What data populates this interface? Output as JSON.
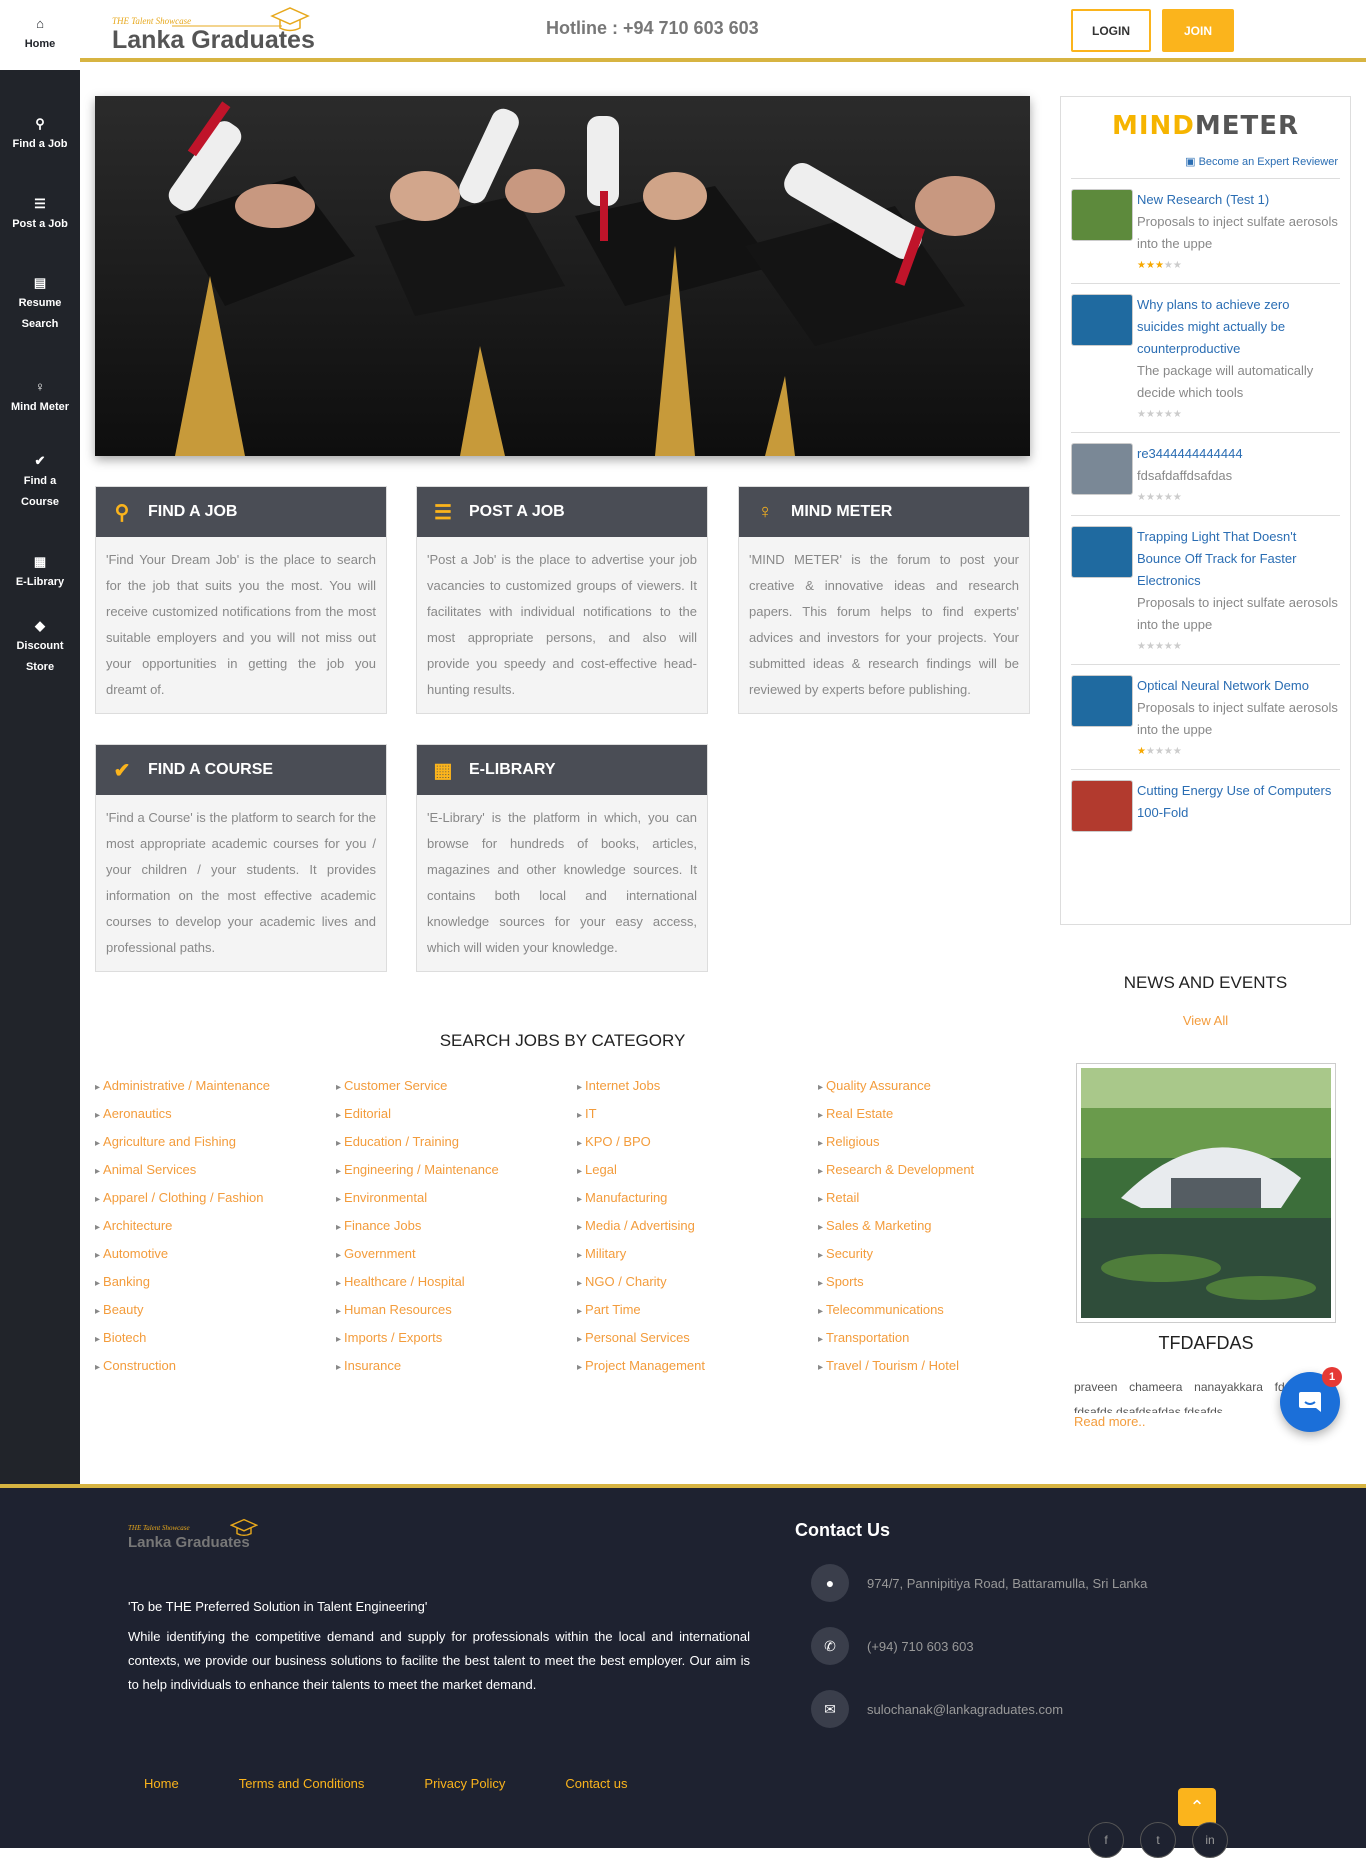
{
  "sidebar": {
    "items": [
      {
        "label": "Home",
        "icon": "home-icon",
        "glyph": "⌂"
      },
      {
        "label": "Find a Job",
        "icon": "search-icon",
        "glyph": "⚲"
      },
      {
        "label": "Post a Job",
        "icon": "list-icon",
        "glyph": "☰"
      },
      {
        "label": "Resume Search",
        "icon": "id-card-icon",
        "glyph": "▤"
      },
      {
        "label": "Mind Meter",
        "icon": "lightbulb-icon",
        "glyph": "♀"
      },
      {
        "label": "Find a Course",
        "icon": "check-icon",
        "glyph": "✔"
      },
      {
        "label": "E-Library",
        "icon": "book-icon",
        "glyph": "▦"
      },
      {
        "label": "Discount Store",
        "icon": "tags-icon",
        "glyph": "◆"
      }
    ]
  },
  "header": {
    "logo_tagline": "THE Talent Showcase",
    "logo_name": "Lanka Graduates",
    "hotline": "Hotline : +94 710 603 603",
    "login": "LOGIN",
    "join": "JOIN"
  },
  "cards": [
    {
      "title": "FIND A JOB",
      "icon": "search-icon",
      "glyph": "⚲",
      "text": "'Find Your Dream Job' is the place to search for the job that suits you the most. You will receive customized notifications from the most suitable employers and you will not miss out your opportunities in getting the job you dreamt of."
    },
    {
      "title": "POST A JOB",
      "icon": "list-icon",
      "glyph": "☰",
      "text": "'Post a Job' is the place to advertise your job vacancies to customized groups of viewers. It facilitates with individual notifications to the most appropriate persons, and also will provide you speedy and cost-effective head-hunting results."
    },
    {
      "title": "MIND METER",
      "icon": "lightbulb-icon",
      "glyph": "♀",
      "text": "'MIND METER' is the forum to post your creative & innovative ideas and research papers. This forum helps to find experts' advices and investors for your projects. Your submitted ideas & research findings will be reviewed by experts before publishing."
    },
    {
      "title": "FIND A COURSE",
      "icon": "check-icon",
      "glyph": "✔",
      "text": "'Find a Course' is the platform to search for the most appropriate academic courses for you / your children / your students. It provides information on the most effective academic courses to develop your academic lives and professional paths."
    },
    {
      "title": "E-LIBRARY",
      "icon": "book-icon",
      "glyph": "▦",
      "text": "'E-Library' is the platform in which, you can browse for hundreds of books, articles, magazines and other knowledge sources. It contains both local and international knowledge sources for your easy access, which will widen your knowledge."
    }
  ],
  "mindmeter": {
    "logo_a": "MIND",
    "logo_b": "METER",
    "reviewer_link": "Become an Expert Reviewer",
    "items": [
      {
        "title": "New Research (Test 1)",
        "desc": "Proposals to inject sulfate aerosols into the uppe",
        "rating": 3,
        "thumb_color": "#5d8a3c"
      },
      {
        "title": "Why plans to achieve zero suicides might actually be counterproductive",
        "desc": "The package will automatically decide which tools",
        "rating": 0,
        "thumb_color": "#1f6aa0"
      },
      {
        "title": "re3444444444444",
        "desc": "fdsafdaffdsafdas",
        "rating": 0,
        "thumb_color": "#7a8896"
      },
      {
        "title": "Trapping Light That Doesn't Bounce Off Track for Faster Electronics",
        "desc": "Proposals to inject sulfate aerosols into the uppe",
        "rating": 0,
        "thumb_color": "#1f6aa0"
      },
      {
        "title": "Optical Neural Network Demo",
        "desc": "Proposals to inject sulfate aerosols into the uppe",
        "rating": 1,
        "thumb_color": "#1f6aa0"
      },
      {
        "title": "Cutting Energy Use of Computers 100-Fold",
        "desc": "",
        "rating": 0,
        "thumb_color": "#b23a2e"
      }
    ]
  },
  "news": {
    "heading": "NEWS AND EVENTS",
    "view_all": "View All",
    "event_title": "TFDAFDAS",
    "event_desc": "praveen chameera nanayakkara fdsfdsafdsa fdsafds dsafdsafdas fdsafds",
    "read_more": "Read more.."
  },
  "chat": {
    "badge": "1"
  },
  "categories": {
    "heading": "SEARCH JOBS BY CATEGORY",
    "columns": [
      [
        "Administrative / Maintenance",
        "Aeronautics",
        "Agriculture and Fishing",
        "Animal Services",
        "Apparel / Clothing / Fashion",
        "Architecture",
        "Automotive",
        "Banking",
        "Beauty",
        "Biotech",
        "Construction"
      ],
      [
        "Customer Service",
        "Editorial",
        "Education / Training",
        "Engineering / Maintenance",
        "Environmental",
        "Finance Jobs",
        "Government",
        "Healthcare / Hospital",
        "Human Resources",
        "Imports / Exports",
        "Insurance"
      ],
      [
        "Internet Jobs",
        "IT",
        "KPO / BPO",
        "Legal",
        "Manufacturing",
        "Media / Advertising",
        "Military",
        "NGO / Charity",
        "Part Time",
        "Personal Services",
        "Project Management"
      ],
      [
        "Quality Assurance",
        "Real Estate",
        "Religious",
        "Research & Development",
        "Retail",
        "Sales & Marketing",
        "Security",
        "Sports",
        "Telecommunications",
        "Transportation",
        "Travel / Tourism / Hotel"
      ]
    ]
  },
  "footer": {
    "logo_tagline": "THE Talent Showcase",
    "logo_name": "Lanka Graduates",
    "quote": "'To be THE Preferred Solution in Talent Engineering'",
    "about": "While identifying the competitive demand and supply for professionals within the local and international contexts, we provide our business solutions to facilite the best talent to meet the best employer. Our aim is to help individuals to enhance their talents to meet the market demand.",
    "contact_heading": "Contact Us",
    "address": "974/7, Pannipitiya Road, Battaramulla, Sri Lanka",
    "phone": "(+94) 710 603 603",
    "email": "sulochanak@lankagraduates.com",
    "links": [
      "Home",
      "Terms and Conditions",
      "Privacy Policy",
      "Contact us"
    ],
    "social": [
      {
        "icon": "facebook-icon",
        "glyph": "f"
      },
      {
        "icon": "twitter-icon",
        "glyph": "t"
      },
      {
        "icon": "linkedin-icon",
        "glyph": "in"
      }
    ]
  },
  "colors": {
    "accent": "#fbb41c",
    "sidebar": "#21242a",
    "footer": "#1e2230",
    "link": "#f39c3c",
    "card_head": "#4a4d55"
  }
}
